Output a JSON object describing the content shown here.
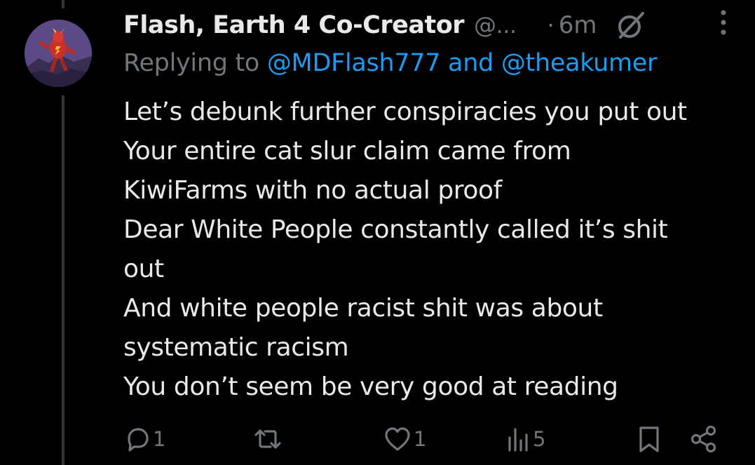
{
  "tweet": {
    "display_name": "Flash, Earth 4 Co-Creator",
    "handle": "@...",
    "separator": "·",
    "time": "6m",
    "replying_prefix": "Replying to ",
    "mention_1": "@MDFlash777",
    "conjunction": " and ",
    "mention_2": "@theakumer",
    "lines": [
      "Let’s debunk further conspiracies you put out",
      "Your entire cat slur claim came from",
      "KiwiFarms with no actual proof",
      "Dear White People constantly called it’s shit",
      "out",
      "And white people racist shit was about",
      "systematic racism",
      "You don’t seem be very good at reading"
    ]
  },
  "actions": {
    "reply_count": "1",
    "like_count": "1",
    "views_count": "5"
  },
  "icons": {
    "grok": "grok-icon",
    "more": "more-vertical-icon",
    "reply": "reply-icon",
    "retweet": "retweet-icon",
    "like": "heart-icon",
    "views": "views-icon",
    "bookmark": "bookmark-icon",
    "share": "share-icon"
  },
  "colors": {
    "background": "#000000",
    "text": "#e7e9ea",
    "muted": "#71767b",
    "link": "#1d9bf0",
    "thread_line": "#333639"
  }
}
